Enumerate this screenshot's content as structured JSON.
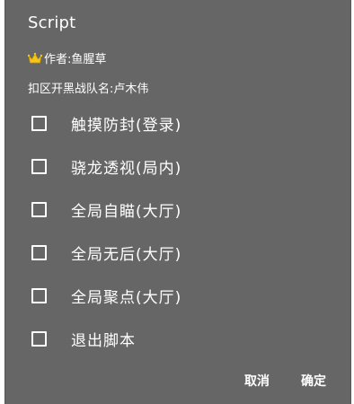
{
  "dialog": {
    "title": "Script",
    "author_line": "作者:鱼腥草",
    "team_line": "扣区开黑战队名:卢木伟",
    "options": [
      {
        "label": "触摸防封(登录)",
        "checked": false
      },
      {
        "label": "骁龙透视(局内)",
        "checked": false
      },
      {
        "label": "全局自瞄(大厅)",
        "checked": false
      },
      {
        "label": "全局无后(大厅)",
        "checked": false
      },
      {
        "label": "全局聚点(大厅)",
        "checked": false
      },
      {
        "label": "退出脚本",
        "checked": false
      }
    ],
    "cancel_label": "取消",
    "confirm_label": "确定"
  },
  "icons": {
    "author_icon": "crown-icon",
    "checkbox_icon": "checkbox-unchecked-icon"
  },
  "colors": {
    "dialog_background": "#666666",
    "text": "#ffffff",
    "crown": "#f5c518"
  }
}
